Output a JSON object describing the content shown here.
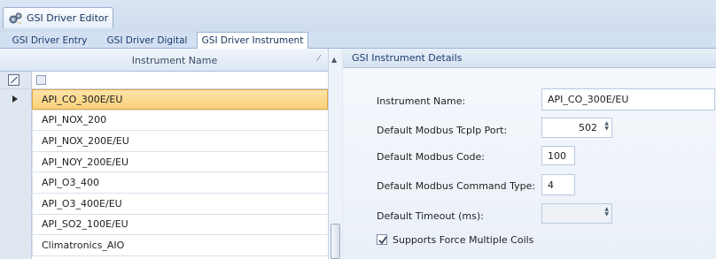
{
  "window": {
    "tab_title": "GSI Driver Editor"
  },
  "sub_tabs": [
    {
      "label": "GSI Driver Entry",
      "active": false
    },
    {
      "label": "GSI Driver Digital",
      "active": false
    },
    {
      "label": "GSI Driver Instrument",
      "active": true
    }
  ],
  "grid": {
    "column_header": "Instrument Name",
    "sort_glyph": "⁄",
    "rows": [
      {
        "name": "API_CO_300E/EU",
        "selected": true
      },
      {
        "name": "API_NOX_200",
        "selected": false
      },
      {
        "name": "API_NOX_200E/EU",
        "selected": false
      },
      {
        "name": "API_NOY_200E/EU",
        "selected": false
      },
      {
        "name": "API_O3_400",
        "selected": false
      },
      {
        "name": "API_O3_400E/EU",
        "selected": false
      },
      {
        "name": "API_SO2_100E/EU",
        "selected": false
      },
      {
        "name": "Climatronics_AIO",
        "selected": false
      }
    ]
  },
  "details": {
    "group_title": "GSI Instrument Details",
    "instrument_name_label": "Instrument Name:",
    "instrument_name_value": "API_CO_300E/EU",
    "tcpip_port_label": "Default Modbus TcpIp Port:",
    "tcpip_port_value": "502",
    "modbus_code_label": "Default Modbus Code:",
    "modbus_code_value": "100",
    "command_type_label": "Default Modbus Command Type:",
    "command_type_value": "4",
    "timeout_label": "Default Timeout (ms):",
    "timeout_value": "",
    "force_coils_label": "Supports Force Multiple Coils",
    "force_coils_checked": true
  },
  "colors": {
    "selection": "#fbd27b",
    "selection_border": "#e3a43f",
    "accent": "#1b3b6f"
  }
}
